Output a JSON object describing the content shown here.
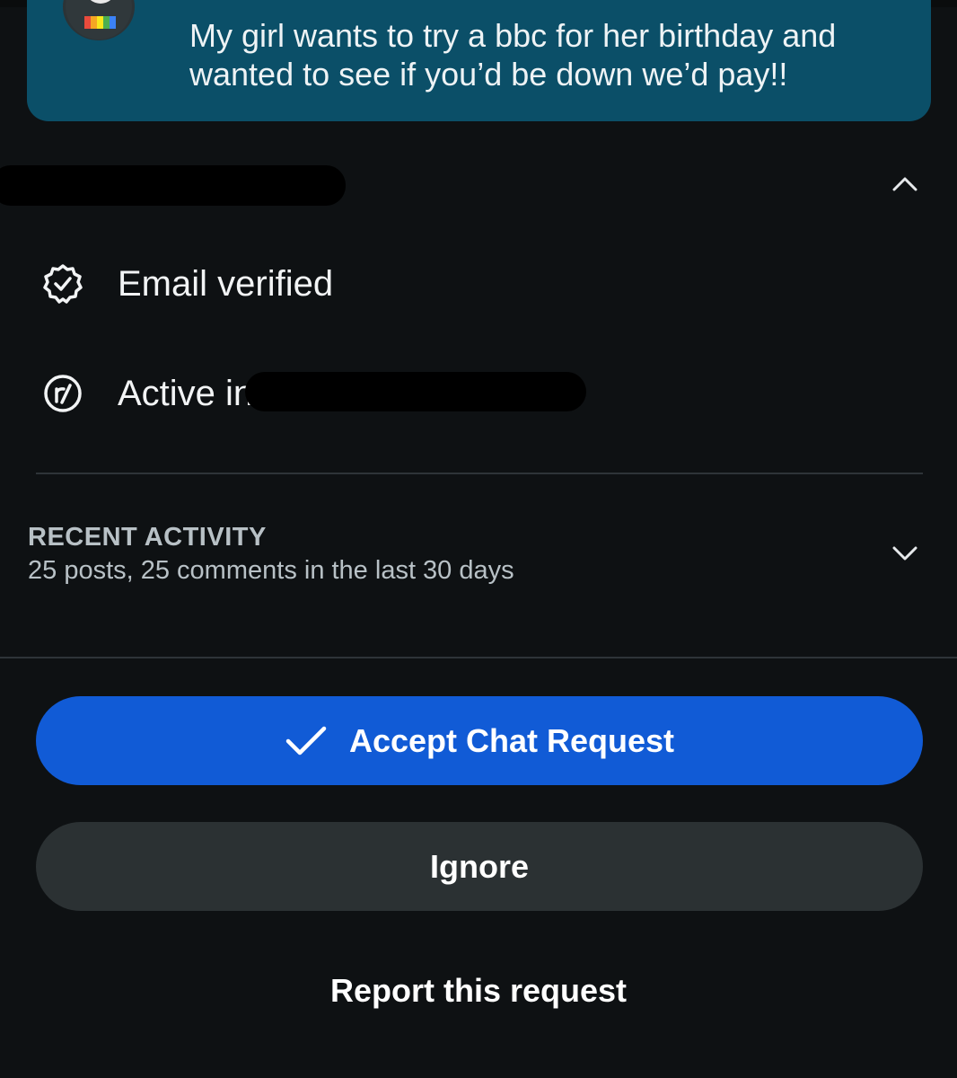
{
  "message": {
    "text": "My girl wants to try a bbc for her birthday and wanted to see if you’d be down we’d pay!!"
  },
  "profile": {
    "collapse_icon": "chevron-up-icon",
    "items": [
      {
        "icon": "verified-badge-icon",
        "label": "Email verified"
      },
      {
        "icon": "subreddit-icon",
        "label": "Active in"
      }
    ]
  },
  "recent_activity": {
    "title": "RECENT ACTIVITY",
    "summary": "25 posts, 25 comments in the last 30 days",
    "expand_icon": "chevron-down-icon"
  },
  "actions": {
    "accept_label": "Accept Chat Request",
    "accept_icon": "checkmark-icon",
    "ignore_label": "Ignore",
    "report_label": "Report this request"
  },
  "colors": {
    "background": "#0e1113",
    "message_bubble": "#0b4f68",
    "accept_button": "#115bd6",
    "ignore_button": "#2b3133"
  }
}
